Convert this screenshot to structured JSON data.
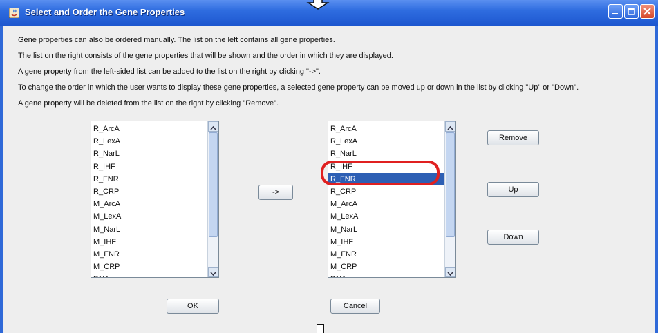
{
  "window": {
    "title": "Select and Order the Gene Properties",
    "titlebar_color": "#2f6de0"
  },
  "description": [
    "Gene properties can also be ordered manually. The list on the left contains all gene properties.",
    "The list on the right consists of the gene properties that will be shown and the order in which they are displayed.",
    "A gene property from the left-sided list can be added to the list on the right by clicking \"->\".",
    "To change the order in which the user wants to display these gene properties, a selected gene property can be moved up or down in the list by clicking \"Up\" or \"Down\".",
    "A gene property will be deleted from the list on the right by clicking \"Remove\"."
  ],
  "left_list": {
    "items": [
      "R_ArcA",
      "R_LexA",
      "R_NarL",
      "R_IHF",
      "R_FNR",
      "R_CRP",
      "M_ArcA",
      "M_LexA",
      "M_NarL",
      "M_IHF",
      "M_FNR",
      "M_CRP",
      "DNA"
    ]
  },
  "right_list": {
    "items": [
      "R_ArcA",
      "R_LexA",
      "R_NarL",
      "R_IHF",
      "R_FNR",
      "R_CRP",
      "M_ArcA",
      "M_LexA",
      "M_NarL",
      "M_IHF",
      "M_FNR",
      "M_CRP",
      "DNA"
    ],
    "selected": "R_FNR",
    "selection_color": "#2d5fb4",
    "annotation_color": "#e02020"
  },
  "buttons": {
    "add": "->",
    "remove": "Remove",
    "up": "Up",
    "down": "Down",
    "ok": "OK",
    "cancel": "Cancel"
  }
}
